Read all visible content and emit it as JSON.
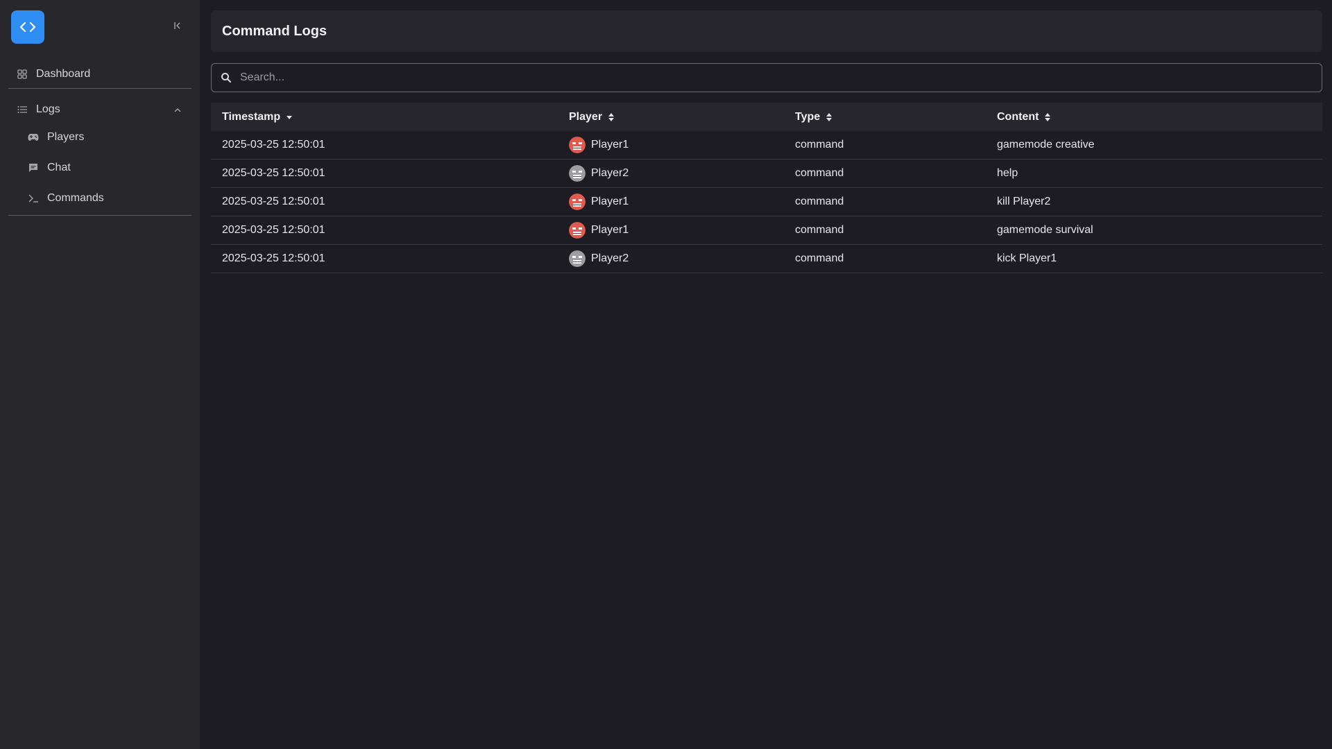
{
  "sidebar": {
    "logo_icon": "code-brackets-icon",
    "collapse_icon": "collapse-left-icon",
    "items": [
      {
        "label": "Dashboard",
        "icon": "grid-icon"
      },
      {
        "label": "Logs",
        "icon": "list-icon",
        "expanded": true,
        "children": [
          {
            "label": "Players",
            "icon": "gamepad-icon"
          },
          {
            "label": "Chat",
            "icon": "chat-icon"
          },
          {
            "label": "Commands",
            "icon": "terminal-icon"
          }
        ]
      }
    ]
  },
  "header": {
    "title": "Command Logs"
  },
  "search": {
    "placeholder": "Search...",
    "value": ""
  },
  "table": {
    "columns": [
      {
        "label": "Timestamp",
        "sort": "desc"
      },
      {
        "label": "Player",
        "sort": "none"
      },
      {
        "label": "Type",
        "sort": "none"
      },
      {
        "label": "Content",
        "sort": "none"
      }
    ],
    "rows": [
      {
        "timestamp": "2025-03-25 12:50:01",
        "player": "Player1",
        "avatar": "red-face",
        "type": "command",
        "content": "gamemode creative"
      },
      {
        "timestamp": "2025-03-25 12:50:01",
        "player": "Player2",
        "avatar": "gray-face",
        "type": "command",
        "content": "help"
      },
      {
        "timestamp": "2025-03-25 12:50:01",
        "player": "Player1",
        "avatar": "red-face",
        "type": "command",
        "content": "kill Player2"
      },
      {
        "timestamp": "2025-03-25 12:50:01",
        "player": "Player1",
        "avatar": "red-face",
        "type": "command",
        "content": "gamemode survival"
      },
      {
        "timestamp": "2025-03-25 12:50:01",
        "player": "Player2",
        "avatar": "gray-face",
        "type": "command",
        "content": "kick Player1"
      }
    ]
  },
  "colors": {
    "accent": "#2e8ef4",
    "background": "#1c1c22",
    "sidebar": "#27272c",
    "avatar_red": "#e05a4f",
    "avatar_gray": "#9e9e9e"
  }
}
